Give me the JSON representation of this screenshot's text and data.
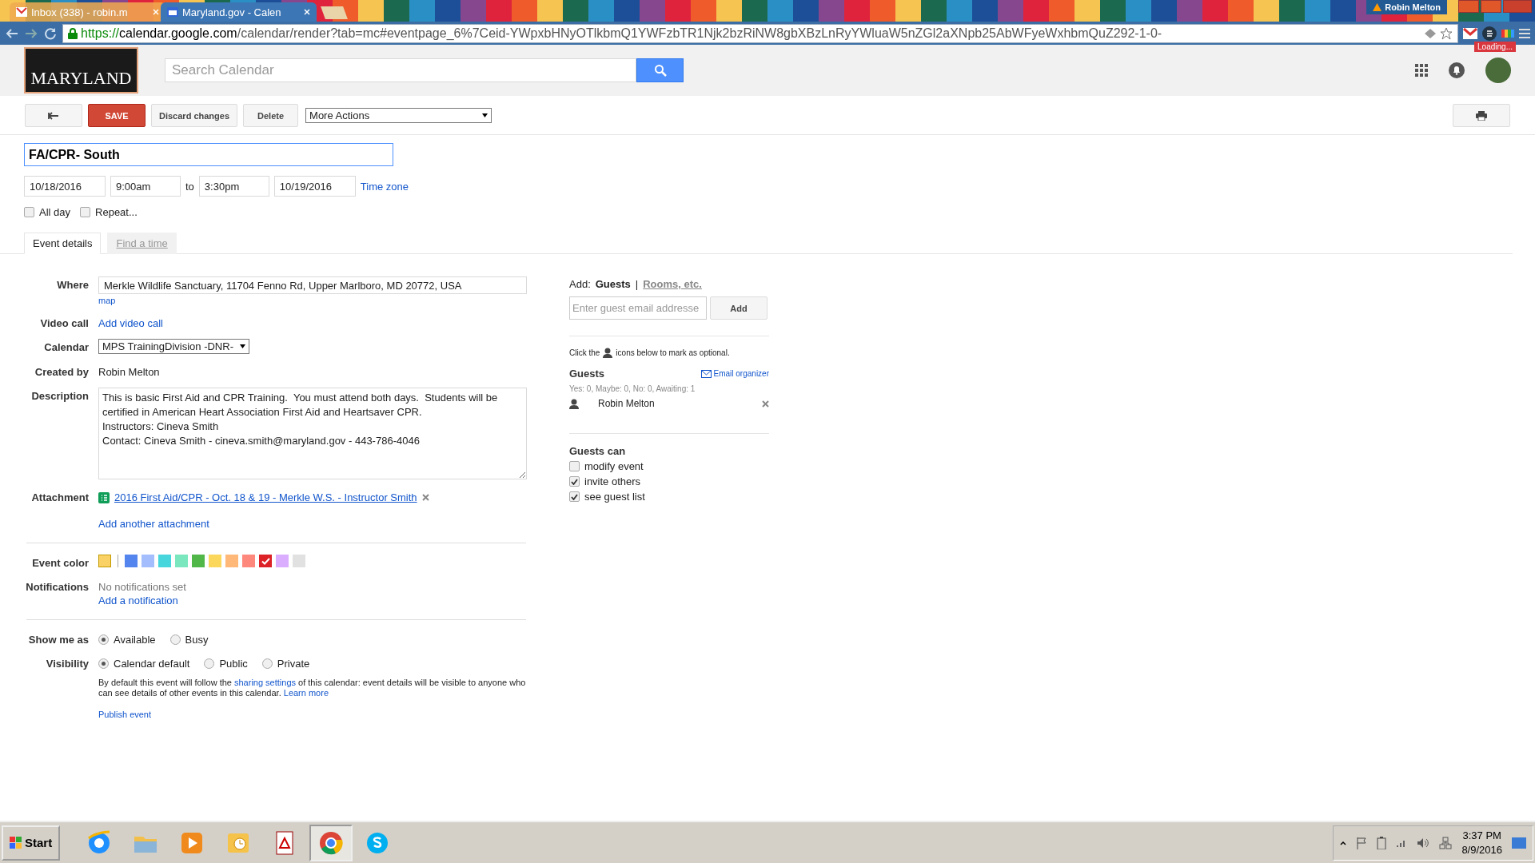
{
  "browser": {
    "tabs": [
      {
        "title": "Inbox (338) - robin.m",
        "selected": false
      },
      {
        "title": "Maryland.gov - Calen",
        "selected": true
      }
    ],
    "user_badge": "Robin Melton",
    "url_scheme": "https://",
    "url_host": "calendar.google.com",
    "url_path": "/calendar/render?tab=mc#eventpage_6%7Ceid-YWpxbHNyOTlkbmQ1YWFzbTR1Njk2bzRiNW8gbXBzLnRyYWluaW5nZGl2aXNpb25AbWFyeWxhbmQuZ292-1-0-",
    "loading_badge": "Loading..."
  },
  "header": {
    "logo_text": "MARYLAND",
    "search_placeholder": "Search Calendar"
  },
  "toolbar": {
    "save": "SAVE",
    "discard": "Discard changes",
    "delete": "Delete",
    "more_actions": "More Actions"
  },
  "event": {
    "title": "FA/CPR- South ",
    "start_date": "10/18/2016",
    "start_time": "9:00am",
    "to": "to",
    "end_time": "3:30pm",
    "end_date": "10/19/2016",
    "time_zone": "Time zone",
    "options": [
      {
        "label": "All day",
        "checked": false
      },
      {
        "label": "Repeat...",
        "checked": false
      }
    ]
  },
  "tabs": [
    {
      "label": "Event details",
      "selected": true
    },
    {
      "label": "Find a time",
      "selected": false
    }
  ],
  "details": {
    "where": {
      "label": "Where",
      "value": "Merkle Wildlife Sanctuary, 11704 Fenno Rd, Upper Marlboro, MD 20772, USA",
      "map_link": "map"
    },
    "video_call": {
      "label": "Video call",
      "link": "Add video call"
    },
    "calendar": {
      "label": "Calendar",
      "value": "MPS TrainingDivision -DNR-"
    },
    "created_by": {
      "label": "Created by",
      "value": "Robin Melton"
    },
    "description": {
      "label": "Description",
      "value": "This is basic First Aid and CPR Training.  You must attend both days.  Students will be certified in American Heart Association First Aid and Heartsaver CPR.\nInstructors: Cineva Smith\nContact: Cineva Smith - cineva.smith@maryland.gov - 443-786-4046"
    },
    "attachment": {
      "label": "Attachment",
      "file": "2016 First Aid/CPR - Oct. 18 & 19 - Merkle W.S. - Instructor Smith",
      "add_link": "Add another attachment"
    },
    "event_color": {
      "label": "Event color",
      "colors": [
        {
          "kind": "default",
          "color": "#fad165",
          "selected": false
        },
        {
          "kind": "palette",
          "color": "#5484ed",
          "selected": false
        },
        {
          "kind": "palette",
          "color": "#a4bdfc",
          "selected": false
        },
        {
          "kind": "palette",
          "color": "#46d6db",
          "selected": false
        },
        {
          "kind": "palette",
          "color": "#7ae7bf",
          "selected": false
        },
        {
          "kind": "palette",
          "color": "#51b749",
          "selected": false
        },
        {
          "kind": "palette",
          "color": "#fbd75b",
          "selected": false
        },
        {
          "kind": "palette",
          "color": "#ffb878",
          "selected": false
        },
        {
          "kind": "palette",
          "color": "#ff887c",
          "selected": false
        },
        {
          "kind": "palette",
          "color": "#dc2127",
          "selected": true
        },
        {
          "kind": "palette",
          "color": "#dbadff",
          "selected": false
        },
        {
          "kind": "palette",
          "color": "#e1e1e1",
          "selected": false
        }
      ]
    },
    "notifications": {
      "label": "Notifications",
      "status": "No notifications set",
      "link": "Add a notification"
    },
    "show_me_as": {
      "label": "Show me as",
      "options": [
        {
          "label": "Available",
          "selected": true
        },
        {
          "label": "Busy",
          "selected": false
        }
      ]
    },
    "visibility": {
      "label": "Visibility",
      "options": [
        {
          "label": "Calendar default",
          "selected": true
        },
        {
          "label": "Public",
          "selected": false
        },
        {
          "label": "Private",
          "selected": false
        }
      ]
    },
    "visibility_note": {
      "before": "By default this event will follow the ",
      "link": "sharing settings",
      "after": " of this calendar: event details will be visible to anyone who can see details of other events in this calendar.  ",
      "learn_more": "Learn more"
    },
    "publish_link": "Publish event"
  },
  "guests": {
    "add_label": "Add:",
    "guests_tab": "Guests",
    "separator": "|",
    "rooms_link": "Rooms, etc.",
    "placeholder": "Enter guest email addresse",
    "add_button": "Add",
    "hint_before": "Click the",
    "hint_after": "icons below to mark as optional.",
    "heading": "Guests",
    "email_link": "Email organizer",
    "summary": "Yes: 0, Maybe: 0, No: 0, Awaiting: 1",
    "list": [
      {
        "name": "Robin Melton"
      }
    ],
    "can_heading": "Guests can",
    "permissions": [
      {
        "label": "modify event",
        "checked": false
      },
      {
        "label": "invite others",
        "checked": true
      },
      {
        "label": "see guest list",
        "checked": true
      }
    ]
  },
  "taskbar": {
    "start": "Start",
    "apps": [
      {
        "kind": "ie",
        "selected": false
      },
      {
        "kind": "folder",
        "selected": false
      },
      {
        "kind": "media",
        "selected": false
      },
      {
        "kind": "outlook",
        "selected": false
      },
      {
        "kind": "acrobat",
        "selected": false
      },
      {
        "kind": "chrome",
        "selected": true
      },
      {
        "kind": "skype",
        "selected": false
      }
    ],
    "time": "3:37 PM",
    "date": "8/9/2016"
  }
}
